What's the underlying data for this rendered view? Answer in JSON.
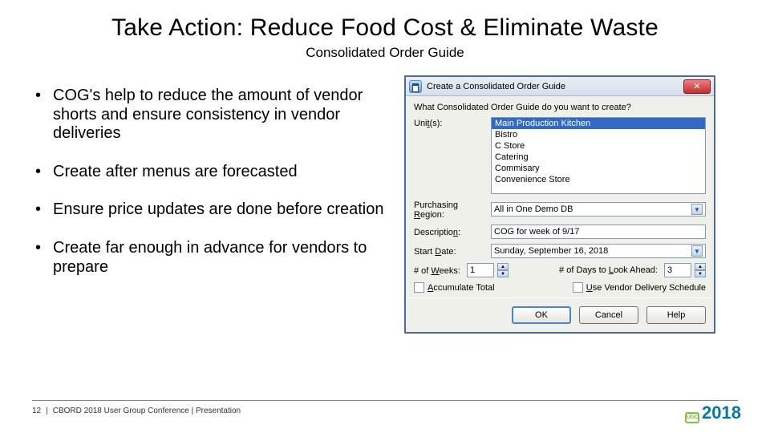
{
  "slide": {
    "title": "Take Action:  Reduce Food Cost & Eliminate Waste",
    "subtitle": "Consolidated Order Guide",
    "bullets": [
      "COG's help to reduce the amount of vendor shorts and ensure consistency in vendor deliveries",
      "Create after menus are forecasted",
      "Ensure price updates are done before creation",
      "Create far enough in advance for vendors to prepare"
    ]
  },
  "dialog": {
    "title": "Create a Consolidated Order Guide",
    "prompt": "What Consolidated Order Guide do you want to create?",
    "units_label": "Unit(s):",
    "units": [
      "Main Production Kitchen",
      "Bistro",
      "C Store",
      "Catering",
      "Commisary",
      "Convenience Store"
    ],
    "region_label": "Purchasing Region:",
    "region_value": "All in One Demo DB",
    "description_label": "Description:",
    "description_value": "COG for week of 9/17",
    "startdate_label": "Start Date:",
    "startdate_value": "Sunday, September 16, 2018",
    "weeks_label": "# of Weeks:",
    "weeks_value": "1",
    "lookahead_label": "# of Days to Look Ahead:",
    "lookahead_value": "3",
    "accumulate_label": "Accumulate Total",
    "vendorsched_label": "Use Vendor Delivery Schedule",
    "ok": "OK",
    "cancel": "Cancel",
    "help": "Help"
  },
  "footer": {
    "page": "12",
    "text": "CBORD 2018 User Group Conference | Presentation"
  },
  "logo": {
    "ugc": "UGC",
    "year": "2018"
  }
}
